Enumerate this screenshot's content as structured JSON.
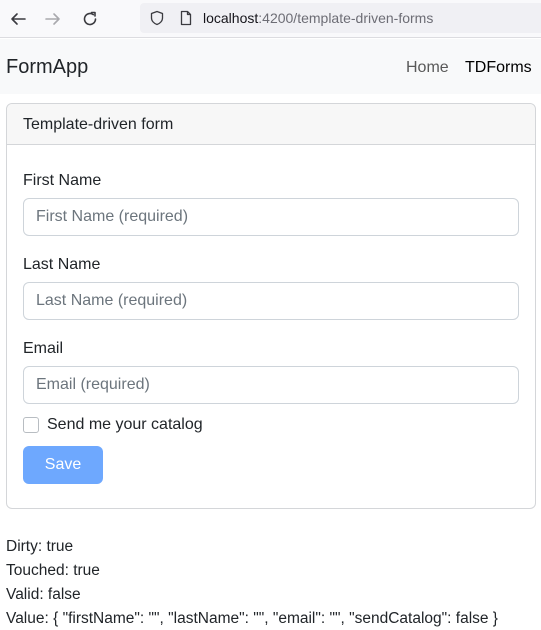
{
  "browser": {
    "url_host": "localhost",
    "url_rest": ":4200/template-driven-forms"
  },
  "navbar": {
    "brand": "FormApp",
    "links": [
      {
        "label": "Home"
      },
      {
        "label": "TDForms"
      }
    ]
  },
  "card": {
    "title": "Template-driven form",
    "fields": {
      "first_name": {
        "label": "First Name",
        "value": "",
        "placeholder": "First Name (required)"
      },
      "last_name": {
        "label": "Last Name",
        "value": "",
        "placeholder": "Last Name (required)"
      },
      "email": {
        "label": "Email",
        "value": "",
        "placeholder": "Email (required)"
      }
    },
    "send_catalog": {
      "label": "Send me your catalog",
      "checked": false
    },
    "save_label": "Save"
  },
  "status": {
    "dirty": "Dirty: true",
    "touched": "Touched: true",
    "valid": "Valid: false",
    "value": "Value: { \"firstName\": \"\", \"lastName\": \"\", \"email\": \"\", \"sendCatalog\": false }"
  },
  "colors": {
    "primary_button_disabled": "#6ea8fe",
    "navbar_bg": "#f8f9fa",
    "card_header_bg": "#f7f7f7"
  },
  "icons": [
    "back-arrow-icon",
    "forward-arrow-icon",
    "reload-icon",
    "shield-icon",
    "page-icon"
  ]
}
